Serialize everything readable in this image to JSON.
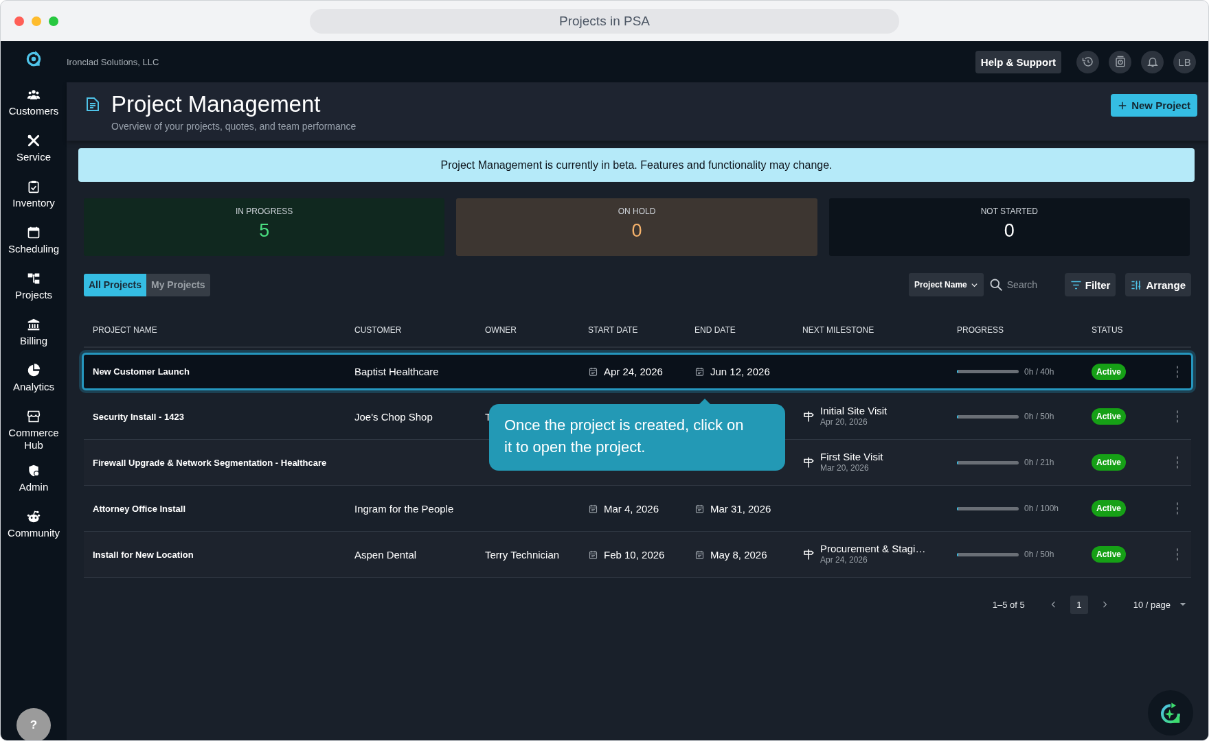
{
  "window": {
    "title": "Projects in PSA"
  },
  "sidebar": {
    "items": [
      {
        "label": "Customers"
      },
      {
        "label": "Service"
      },
      {
        "label": "Inventory"
      },
      {
        "label": "Scheduling"
      },
      {
        "label": "Projects"
      },
      {
        "label": "Billing"
      },
      {
        "label": "Analytics"
      },
      {
        "label": "Commerce Hub"
      },
      {
        "label": "Admin"
      },
      {
        "label": "Community"
      }
    ],
    "help_button": "?"
  },
  "topbar": {
    "company": "Ironclad Solutions, LLC",
    "help_button": "Help & Support",
    "avatar": "LB"
  },
  "header": {
    "title": "Project Management",
    "subtitle": "Overview of your projects, quotes, and team performance",
    "new_button": "New Project"
  },
  "banner": "Project Management is currently in beta. Features and functionality may change.",
  "stats": [
    {
      "label": "IN PROGRESS",
      "value": "5",
      "color": "#4ade80"
    },
    {
      "label": "ON HOLD",
      "value": "0",
      "color": "#f5b26b"
    },
    {
      "label": "NOT STARTED",
      "value": "0",
      "color": "#ffffff"
    }
  ],
  "tabs": [
    {
      "label": "All Projects",
      "selected": true
    },
    {
      "label": "My Projects",
      "selected": false
    }
  ],
  "toolbar": {
    "field_select": "Project Name",
    "search": {
      "placeholder": "Search"
    },
    "filter": "Filter",
    "arrange": "Arrange"
  },
  "table": {
    "columns": [
      "PROJECT NAME",
      "CUSTOMER",
      "OWNER",
      "START DATE",
      "END DATE",
      "NEXT MILESTONE",
      "PROGRESS",
      "STATUS"
    ],
    "rows": [
      {
        "name": "New Customer Launch",
        "customer": "Baptist Healthcare",
        "start_date": "Apr 24, 2026",
        "end_date": "Jun 12, 2026",
        "level": 0,
        "hours": "0h / 40h",
        "status": "Active",
        "selected": true
      },
      {
        "name": "Security Install - 1423",
        "customer": "Joe's Chop Shop",
        "owner": "T",
        "milestone": {
          "title": "Initial Site Visit",
          "date": "Apr 20, 2026"
        },
        "level": 0,
        "hours": "0h / 50h",
        "status": "Active",
        "selected": false
      },
      {
        "name": "Firewall Upgrade & Network Segmentation - Healthcare",
        "milestone": {
          "title": "First Site Visit",
          "date": "Mar 20, 2026"
        },
        "level": 0,
        "hours": "0h / 21h",
        "status": "Active",
        "selected": false
      },
      {
        "name": "Attorney Office Install",
        "customer": "Ingram for the People",
        "start_date": "Mar 4, 2026",
        "end_date": "Mar 31, 2026",
        "level": 0,
        "hours": "0h / 100h",
        "status": "Active",
        "selected": false
      },
      {
        "name": "Install for New Location",
        "customer": "Aspen Dental",
        "owner": "Terry Technician",
        "start_date": "Feb 10, 2026",
        "end_date": "May 8, 2026",
        "milestone": {
          "title": "Procurement & Stagi…",
          "date": "Apr 24, 2026"
        },
        "level": 0,
        "hours": "0h / 50h",
        "status": "Active",
        "selected": false
      }
    ]
  },
  "pagination": {
    "range": "1–5 of 5",
    "pages": [
      {
        "label": "1",
        "selected": true
      }
    ],
    "page_size": "10 / page"
  },
  "tooltip": "Once the project is created, click on it to open the project."
}
